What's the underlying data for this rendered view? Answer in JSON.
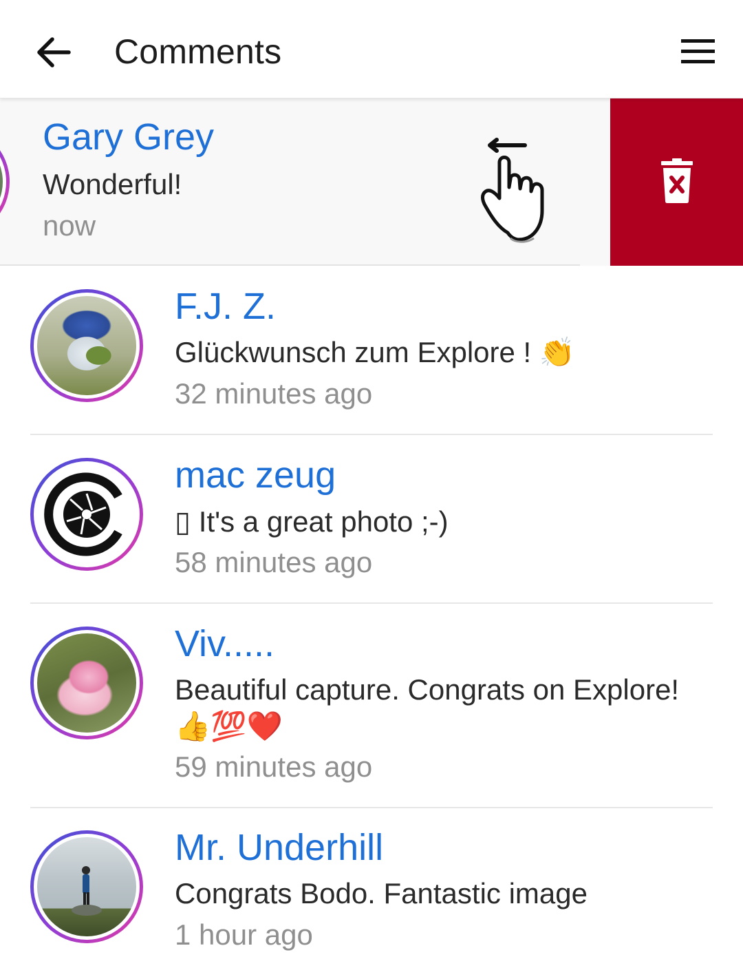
{
  "app_bar": {
    "title": "Comments",
    "back_icon": "arrow-left-icon",
    "menu_icon": "hamburger-menu-icon"
  },
  "swiped_comment": {
    "author": "Gary Grey",
    "text": "Wonderful!",
    "time": "now",
    "delete_icon": "trash-x-icon",
    "delete_color": "#b00020",
    "gesture_icon": "swipe-left-hand-icon"
  },
  "comments": [
    {
      "author": "F.J. Z.",
      "text": "Glückwunsch zum Explore ! 👏",
      "time": "32 minutes ago"
    },
    {
      "author": "mac zeug",
      "text": "▯ It's a great photo ;-)",
      "time": "58 minutes ago"
    },
    {
      "author": "Viv.....",
      "text": "Beautiful capture. Congrats on Explore!",
      "text_line2": "👍💯❤️",
      "time": "59 minutes ago"
    },
    {
      "author": "Mr. Underhill",
      "text": "Congrats Bodo. Fantastic image",
      "time": "1 hour ago"
    }
  ],
  "colors": {
    "author_name": "#1e6fd6",
    "avatar_ring_start": "#3b52d6",
    "avatar_ring_end": "#e23aa6"
  }
}
